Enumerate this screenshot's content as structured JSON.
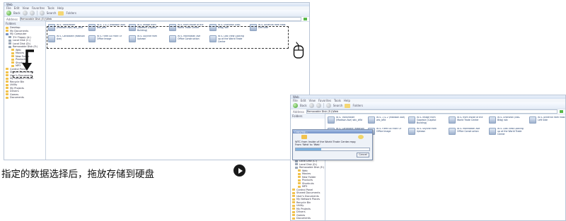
{
  "caption": "指定的数据选择后，拖放存储到硬盘",
  "window1": {
    "title": "Web",
    "menu": [
      "File",
      "Edit",
      "View",
      "Favorites",
      "Tools",
      "Help"
    ],
    "toolbar": {
      "back": "Back",
      "search": "Search",
      "folders": "Folders"
    },
    "address_label": "Address",
    "address": "Removable Disk (E:)\\Web",
    "nav_title": "Folders",
    "tree": [
      "Desktop",
      "My Documents",
      "My Computer",
      "3½ Floppy (A:)",
      "Local Disk (C:)",
      "Local Disk (D:)",
      "Removable Disk (E:)",
      "Web",
      "Movies",
      "New Folder",
      "Products",
      "Shortcuts",
      "MP3",
      "Control Panel",
      "Shared Documents",
      "User's Documents",
      "My Network Places",
      "Recycle Bin",
      "Utility",
      "My Projects",
      "Drivers",
      "Games",
      "Documents"
    ],
    "files": [
      "WTC Transmitter (Madison Ave) wtc_bfld",
      "WTC 1 & 2 (Madison Ave) wtc_bfld",
      "WTC Image from Goodwin (Capitol Building)",
      "WTC from Inside of the World Trade Center",
      "WTC Unknown (NBC Bldg) wtc",
      "WTC Antenna from Mast Left Side",
      "WTC Candidate (Madison Ave)",
      "WTC Fleet Go Front Of Office Image",
      "WTC Skyline from Uptown",
      "WTC Manhattan Ave Office Construction",
      "WTC Last View Looking up at the World Trade Center"
    ]
  },
  "window2": {
    "title": "Web",
    "address": "Removable Disk (E:)\\Web",
    "dialog": {
      "title": "Copying...",
      "text": "WTC from Inside of the World Trade Center.mpg",
      "subtext": "From 'Web' to 'Web'",
      "cancel": "Cancel",
      "progress": 0.35
    }
  }
}
